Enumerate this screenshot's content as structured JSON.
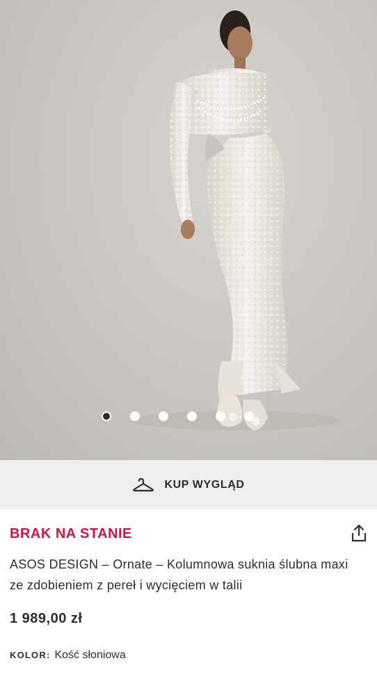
{
  "gallery": {
    "image_alt": "",
    "dots": [
      true,
      false,
      false,
      false,
      false,
      false
    ]
  },
  "look": {
    "label": "KUP WYGLĄD",
    "icon": "hanger-icon"
  },
  "product": {
    "status": "BRAK NA STANIE",
    "title": "ASOS DESIGN – Ornate – Kolumnowa suknia ślubna maxi ze zdobieniem z pereł i wycięciem w talii",
    "price": "1 989,00 zł",
    "color_key": "KOLOR:",
    "color_value": "Kość słoniowa",
    "share_icon": "share-icon"
  },
  "colors": {
    "status_red": "#d01345",
    "text": "#2d2d2d",
    "bar": "#eeeeee"
  }
}
